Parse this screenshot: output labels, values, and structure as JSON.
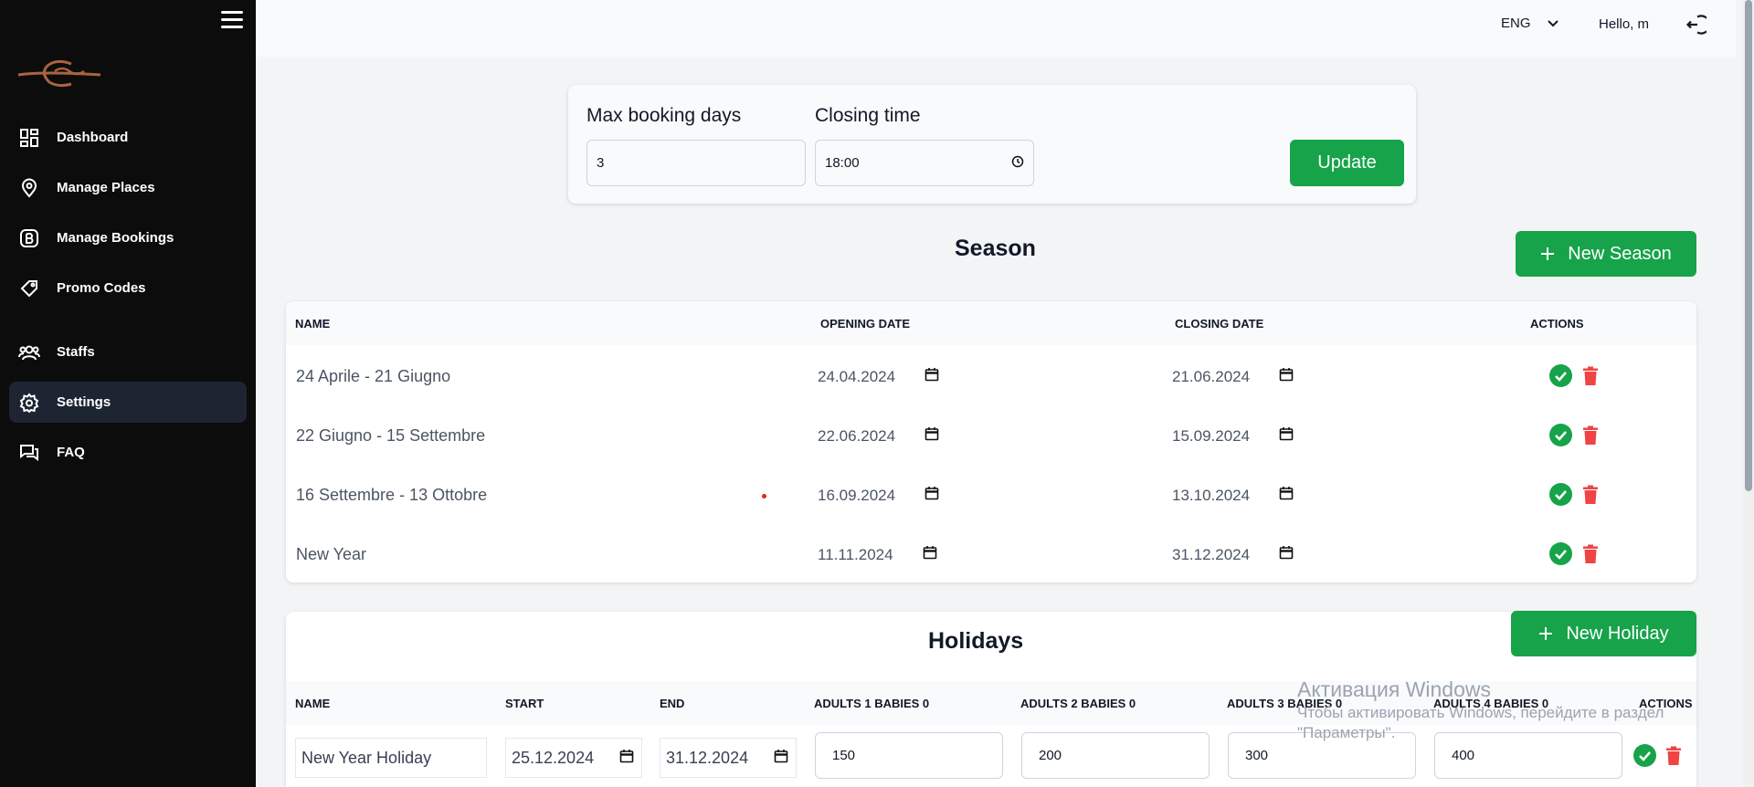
{
  "sidebar": {
    "items": [
      {
        "label": "Dashboard",
        "icon": "dashboard-icon"
      },
      {
        "label": "Manage Places",
        "icon": "map-pin-icon"
      },
      {
        "label": "Manage Bookings",
        "icon": "booking-icon"
      },
      {
        "label": "Promo Codes",
        "icon": "tag-icon"
      },
      {
        "label": "Staffs",
        "icon": "users-icon"
      },
      {
        "label": "Settings",
        "icon": "gear-icon"
      },
      {
        "label": "FAQ",
        "icon": "chat-icon"
      }
    ],
    "active": "Settings"
  },
  "header": {
    "language": "ENG",
    "greeting": "Hello, m"
  },
  "config": {
    "max_booking_label": "Max booking days",
    "max_booking_value": "3",
    "closing_time_label": "Closing time",
    "closing_time_value": "18:00",
    "update_label": "Update"
  },
  "season": {
    "title": "Season",
    "new_button": "New Season",
    "columns": [
      "NAME",
      "OPENING DATE",
      "CLOSING DATE",
      "ACTIONS"
    ],
    "rows": [
      {
        "name": "24 Aprile - 21 Giugno",
        "opening": "24.04.2024",
        "closing": "21.06.2024"
      },
      {
        "name": "22 Giugno - 15 Settembre",
        "opening": "22.06.2024",
        "closing": "15.09.2024"
      },
      {
        "name": "16 Settembre - 13 Ottobre",
        "opening": "16.09.2024",
        "closing": "13.10.2024"
      },
      {
        "name": "New Year",
        "opening": "11.11.2024",
        "closing": "31.12.2024"
      }
    ]
  },
  "holidays": {
    "title": "Holidays",
    "new_button": "New Holiday",
    "columns": [
      "NAME",
      "START",
      "END",
      "ADULTS 1 BABIES 0",
      "ADULTS 2 BABIES 0",
      "ADULTS 3 BABIES 0",
      "ADULTS 4 BABIES 0",
      "ACTIONS"
    ],
    "rows": [
      {
        "name": "New Year Holiday",
        "start": "25.12.2024",
        "end": "31.12.2024",
        "a1": "150",
        "a2": "200",
        "a3": "300",
        "a4": "400"
      }
    ]
  },
  "watermark": {
    "line1": "Активация Windows",
    "line2": "Чтобы активировать Windows, перейдите в раздел",
    "line3": "\"Параметры\"."
  },
  "colors": {
    "sidebar_bg": "#0c0c0d",
    "active_item_bg": "#1e2532",
    "accent_green": "#16a34a",
    "danger_red": "#ef4444",
    "logo_copper": "#a9643f"
  }
}
